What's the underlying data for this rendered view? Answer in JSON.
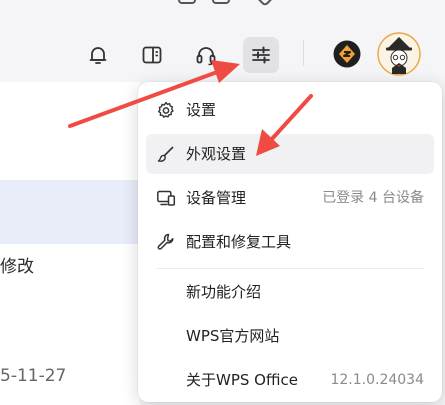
{
  "menu": {
    "items": [
      {
        "label": "设置",
        "icon": "gear-icon"
      },
      {
        "label": "外观设置",
        "icon": "brush-icon"
      },
      {
        "label": "设备管理",
        "icon": "devices-icon",
        "right": "已登录 4 台设备"
      },
      {
        "label": "配置和修复工具",
        "icon": "wrench-icon"
      },
      {
        "label": "新功能介绍"
      },
      {
        "label": "WPS官方网站"
      },
      {
        "label": "关于WPS Office",
        "right": "12.1.0.24034"
      }
    ]
  },
  "left": {
    "text_modify": "修改",
    "date": "5-11-27"
  },
  "colors": {
    "arrow": "#ef4b43",
    "active_bg": "#e1e2e6",
    "selected_row": "#e8edf9"
  }
}
